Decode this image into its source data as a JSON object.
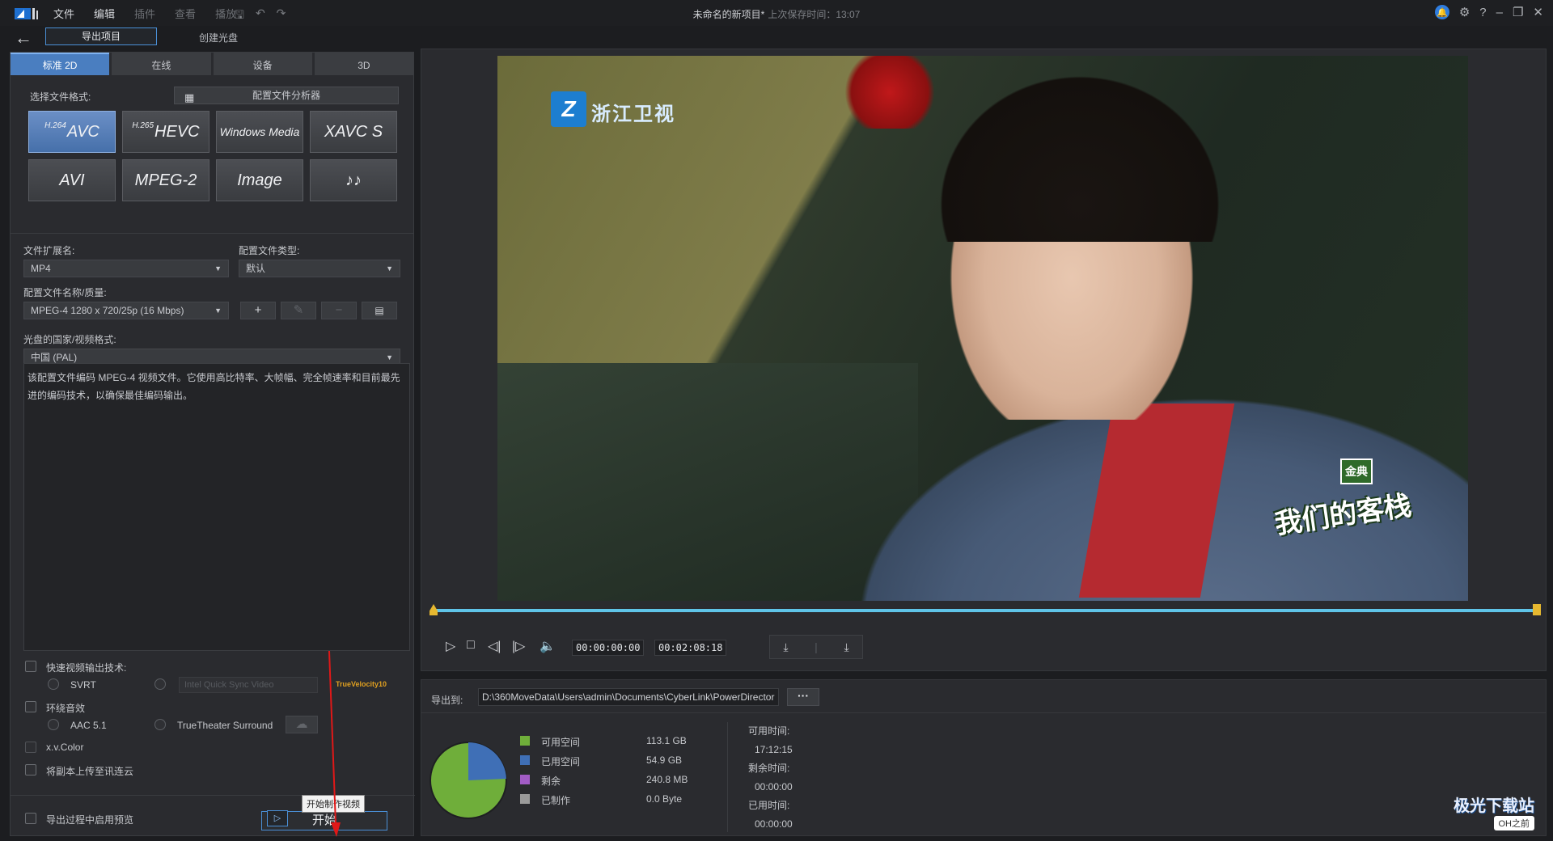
{
  "titlebar": {
    "menus": [
      "文件",
      "编辑",
      "插件",
      "查看",
      "播放"
    ],
    "project_title": "未命名的新项目*",
    "saved_text": "上次保存时间：13:07"
  },
  "subbar": {
    "export_tab": "导出项目",
    "disc_tab": "创建光盘"
  },
  "left": {
    "tabs": [
      "标准 2D",
      "在线",
      "设备",
      "3D"
    ],
    "select_format_label": "选择文件格式:",
    "analyzer_label": "配置文件分析器",
    "codecs": [
      {
        "sup": "H.264",
        "label": "AVC"
      },
      {
        "sup": "H.265",
        "label": "HEVC"
      },
      {
        "sup": "",
        "label": "Windows Media"
      },
      {
        "sup": "",
        "label": "XAVC S"
      },
      {
        "sup": "",
        "label": "AVI"
      },
      {
        "sup": "",
        "label": "MPEG-2"
      },
      {
        "sup": "",
        "label": "Image"
      },
      {
        "sup": "",
        "label": "♪♪"
      }
    ],
    "ext_label": "文件扩展名:",
    "ext_value": "MP4",
    "profile_type_label": "配置文件类型:",
    "profile_type_value": "默认",
    "profile_name_label": "配置文件名称/质量:",
    "profile_name_value": "MPEG-4 1280 x 720/25p (16 Mbps)",
    "region_label": "光盘的国家/视频格式:",
    "region_value": "中国 (PAL)",
    "description": "该配置文件编码 MPEG-4 视频文件。它使用高比特率、大帧幅、完全帧速率和目前最先进的编码技术，以确保最佳编码输出。",
    "fast_video_label": "快速视频输出技术:",
    "svrt_label": "SVRT",
    "intel_label": "Intel Quick Sync Video",
    "velocity_label": "TrueVelocity10",
    "surround_label": "环绕音效",
    "aac_label": "AAC 5.1",
    "truetheater_label": "TrueTheater Surround",
    "xvcolor_label": "x.v.Color",
    "upload_label": "将副本上传至讯连云",
    "preview_label": "导出过程中启用预览",
    "start_label": "开始",
    "tooltip": "开始制作视频"
  },
  "preview": {
    "video_logo": "Z",
    "video_channel": "浙江卫视",
    "show_title": "我们的客栈",
    "show_badge": "金典",
    "time_current": "00:00:00:00",
    "time_total": "00:02:08:18"
  },
  "output": {
    "export_to_label": "导出到:",
    "path": "D:\\360MoveData\\Users\\admin\\Documents\\CyberLink\\PowerDirector",
    "browse": "···",
    "legend": [
      {
        "name": "可用空间",
        "value": "113.1  GB",
        "color": "#6fae3a"
      },
      {
        "name": "已用空间",
        "value": "54.9  GB",
        "color": "#3f6fb6"
      },
      {
        "name": "剩余",
        "value": "240.8  MB",
        "color": "#a25cc6"
      },
      {
        "name": "已制作",
        "value": "0.0  Byte",
        "color": "#9a9a9a"
      }
    ],
    "times": [
      {
        "label": "可用时间:",
        "value": "17:12:15"
      },
      {
        "label": "剩余时间:",
        "value": "00:00:00"
      },
      {
        "label": "已用时间:",
        "value": "00:00:00"
      }
    ]
  },
  "watermark": {
    "line1": "极光下载站",
    "line2": "OH之前"
  }
}
